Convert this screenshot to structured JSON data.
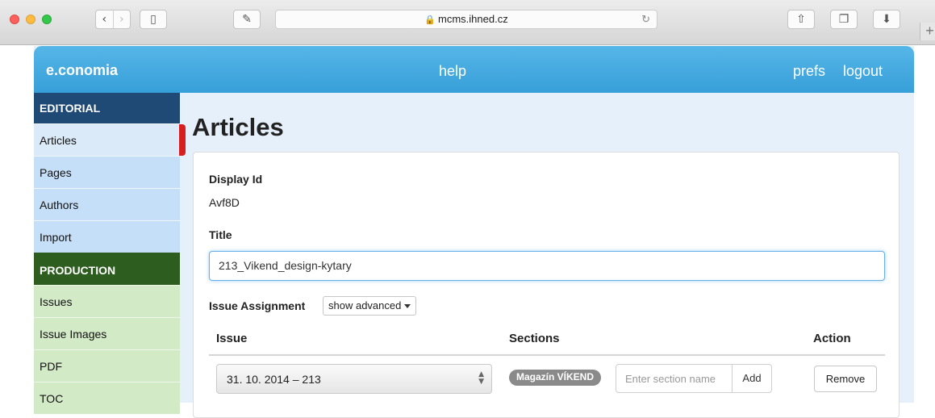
{
  "browser": {
    "url": "mcms.ihned.cz",
    "back_glyph": "‹",
    "forward_glyph": "›",
    "lock_glyph": "🔒",
    "reload_glyph": "↻",
    "share_glyph": "⇧",
    "tabs_glyph": "❐",
    "download_glyph": "⬇",
    "sidebar_glyph": "▯",
    "reader_glyph": "✎",
    "newtab_glyph": "+"
  },
  "header": {
    "brand": "e.conomia",
    "help": "help",
    "prefs": "prefs",
    "logout": "logout"
  },
  "sidebar": {
    "editorial_heading": "EDITORIAL",
    "editorial_items": [
      "Articles",
      "Pages",
      "Authors",
      "Import"
    ],
    "production_heading": "PRODUCTION",
    "production_items": [
      "Issues",
      "Issue Images",
      "PDF",
      "TOC"
    ],
    "active_item": "Articles"
  },
  "main": {
    "title": "Articles",
    "display_id_label": "Display Id",
    "display_id_value": "Avf8D",
    "title_label": "Title",
    "title_value": "213_Vikend_design-kytary",
    "issue_assignment_label": "Issue Assignment",
    "show_advanced_label": "show advanced",
    "table": {
      "headers": [
        "Issue",
        "Sections",
        "Action"
      ],
      "rows": [
        {
          "issue": "31. 10. 2014 – 213",
          "section_badge": "Magazín VÍKEND",
          "section_placeholder": "Enter section name",
          "add_label": "Add",
          "action_label": "Remove"
        }
      ]
    }
  },
  "colors": {
    "topbar": "#3aa7dd",
    "editorial_head": "#1f4a75",
    "production_head": "#2d5e1f",
    "editorial_item_bg": "#c6dff8",
    "production_item_bg": "#d3eac7",
    "active_marker": "#d62020"
  }
}
